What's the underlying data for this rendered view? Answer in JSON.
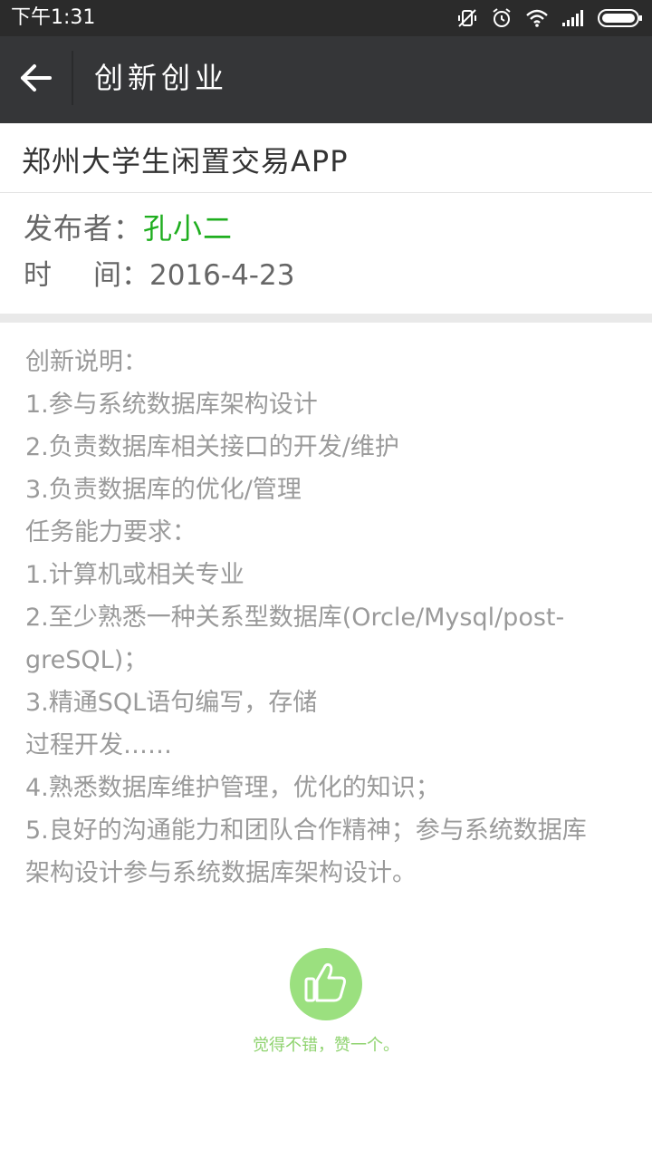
{
  "status_bar": {
    "time": "下午1:31",
    "icons": [
      "vibrate-off-icon",
      "alarm-icon",
      "wifi-icon",
      "signal-icon",
      "battery-icon"
    ]
  },
  "header": {
    "title": "创新创业",
    "back_icon": "back-arrow-icon"
  },
  "article": {
    "title": "郑州大学生闲置交易APP",
    "publisher_label": "发布者",
    "publisher_sep": "：",
    "publisher_name": "孔小二",
    "time_label_1": "时",
    "time_label_2": "间",
    "time_sep": "：",
    "time_value": "2016-4-23",
    "lines": [
      "创新说明：",
      "1.参与系统数据库架构设计",
      "2.负责数据库相关接口的开发/维护",
      "3.负责数据库的优化/管理",
      "任务能力要求：",
      "1.计算机或相关专业",
      "2.至少熟悉一种关系型数据库(Orcle/Mysql/post-",
      "greSQL)；",
      "3.精通SQL语句编写，存储",
      "过程开发……",
      "4.熟悉数据库维护管理，优化的知识；",
      "5.良好的沟通能力和团队合作精神；参与系统数据库",
      "架构设计参与系统数据库架构设计。"
    ]
  },
  "like": {
    "icon": "thumbs-up-icon",
    "text": "觉得不错，赞一个。"
  },
  "colors": {
    "status_bar_bg": "#2b2b2b",
    "title_bar_bg": "#353638",
    "publisher_name": "#1fae1f",
    "like_circle": "#9be07f",
    "like_text": "#8fd36f"
  }
}
